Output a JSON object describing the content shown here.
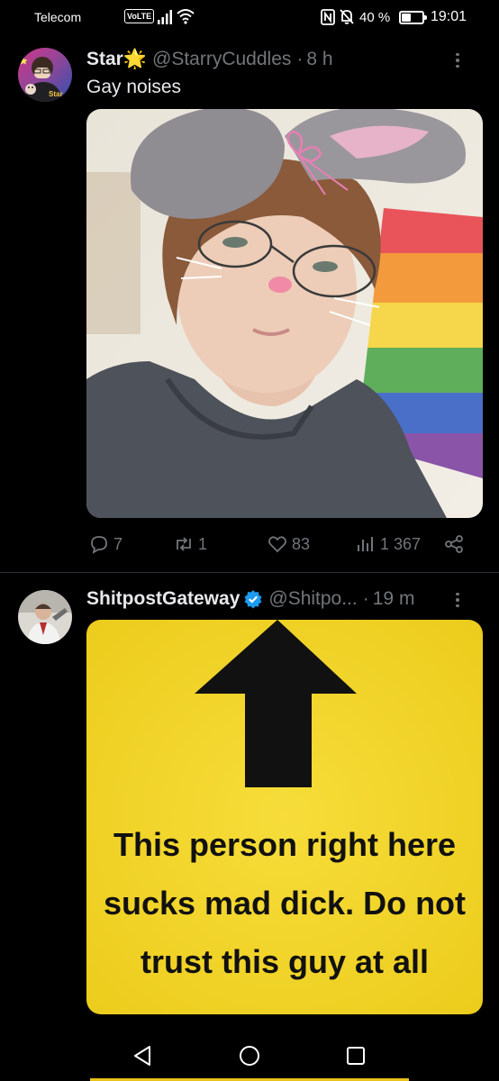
{
  "status_bar": {
    "carrier": "Telecom",
    "volte": "VoLTE",
    "battery_percent": "40 %",
    "battery_level": 0.4,
    "time": "19:01"
  },
  "tweets": [
    {
      "display_name": "Star🌟",
      "handle": "@StarryCuddles",
      "time": "8 h",
      "separator": "·",
      "text": "Gay noises",
      "avatar_badge_text": "Star",
      "stats": {
        "replies": "7",
        "retweets": "1",
        "likes": "83",
        "views": "1 367"
      }
    },
    {
      "display_name": "ShitpostGateway",
      "handle": "@Shitpo...",
      "time": "19 m",
      "separator": "·",
      "verified": true,
      "image_text": [
        "This person right here",
        "sucks mad dick. Do not",
        "trust this guy at all"
      ]
    }
  ],
  "icons": {
    "reply": "reply-icon",
    "retweet": "retweet-icon",
    "like": "heart-icon",
    "views": "views-icon",
    "share": "share-icon",
    "more": "more-icon",
    "verified": "verified-badge-icon"
  },
  "colors": {
    "background": "#000000",
    "text_primary": "#e7e9ea",
    "text_secondary": "#71767b",
    "divider": "#2f3336",
    "verified_blue": "#1d9bf0",
    "meme_yellow": "#f4d724"
  }
}
